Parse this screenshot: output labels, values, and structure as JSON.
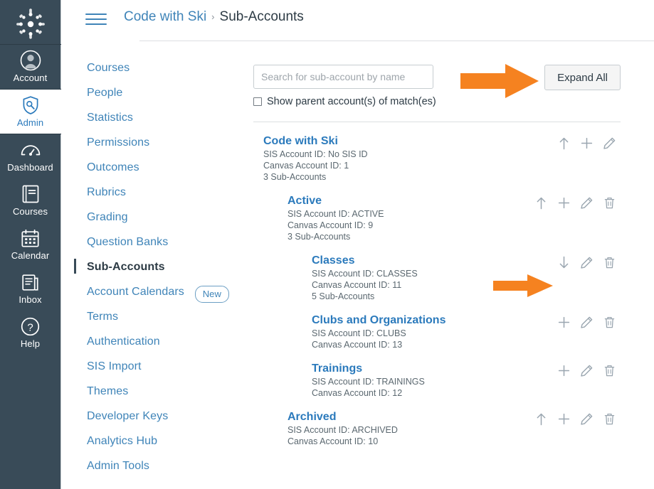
{
  "colors": {
    "global_nav_bg": "#394B58",
    "link_blue": "#3f84b8",
    "heading_blue": "#2B7ABC",
    "text_dark": "#2D3B45",
    "annotation_orange": "#F58220",
    "icon_gray": "#9aa6b0",
    "border": "#c7cdd1"
  },
  "global_nav": {
    "logo_name": "canvas-logo",
    "items": [
      {
        "label": "Account",
        "icon": "user-avatar-icon",
        "active": false
      },
      {
        "label": "Admin",
        "icon": "shield-wrench-icon",
        "active": true
      },
      {
        "label": "Dashboard",
        "icon": "dashboard-gauge-icon",
        "active": false
      },
      {
        "label": "Courses",
        "icon": "book-icon",
        "active": false
      },
      {
        "label": "Calendar",
        "icon": "calendar-icon",
        "active": false
      },
      {
        "label": "Inbox",
        "icon": "inbox-tray-icon",
        "active": false
      },
      {
        "label": "Help",
        "icon": "question-circle-icon",
        "active": false
      }
    ]
  },
  "header": {
    "menu_icon": "hamburger-menu-icon",
    "breadcrumb": {
      "root": "Code with Ski",
      "separator": "›",
      "current": "Sub-Accounts"
    }
  },
  "account_nav": {
    "items": [
      {
        "label": "Courses",
        "active": false
      },
      {
        "label": "People",
        "active": false
      },
      {
        "label": "Statistics",
        "active": false
      },
      {
        "label": "Permissions",
        "active": false
      },
      {
        "label": "Outcomes",
        "active": false
      },
      {
        "label": "Rubrics",
        "active": false
      },
      {
        "label": "Grading",
        "active": false
      },
      {
        "label": "Question Banks",
        "active": false
      },
      {
        "label": "Sub-Accounts",
        "active": true
      },
      {
        "label": "Account Calendars",
        "active": false,
        "badge": "New"
      },
      {
        "label": "Terms",
        "active": false
      },
      {
        "label": "Authentication",
        "active": false
      },
      {
        "label": "SIS Import",
        "active": false
      },
      {
        "label": "Themes",
        "active": false
      },
      {
        "label": "Developer Keys",
        "active": false
      },
      {
        "label": "Analytics Hub",
        "active": false
      },
      {
        "label": "Admin Tools",
        "active": false
      }
    ]
  },
  "toolbar": {
    "search_value": "",
    "search_placeholder": "Search for sub-account by name",
    "expand_all_label": "Expand All",
    "show_parents_label": "Show parent account(s) of match(es)",
    "show_parents_checked": false
  },
  "accounts": [
    {
      "name": "Code with Ski",
      "depth": 0,
      "sis_id_line": "SIS Account ID: No SIS ID",
      "canvas_id_line": "Canvas Account ID: 1",
      "sub_count_line": "3 Sub-Accounts",
      "actions": [
        "collapse-arrow-up-icon",
        "add-subaccount-plus-icon",
        "edit-pencil-icon"
      ]
    },
    {
      "name": "Active",
      "depth": 1,
      "sis_id_line": "SIS Account ID: ACTIVE",
      "canvas_id_line": "Canvas Account ID: 9",
      "sub_count_line": "3 Sub-Accounts",
      "actions": [
        "collapse-arrow-up-icon",
        "add-subaccount-plus-icon",
        "edit-pencil-icon",
        "delete-trash-icon"
      ]
    },
    {
      "name": "Classes",
      "depth": 2,
      "sis_id_line": "SIS Account ID: CLASSES",
      "canvas_id_line": "Canvas Account ID: 11",
      "sub_count_line": "5 Sub-Accounts",
      "actions": [
        "expand-arrow-down-icon",
        "edit-pencil-icon",
        "delete-trash-icon"
      ]
    },
    {
      "name": "Clubs and Organizations",
      "depth": 2,
      "sis_id_line": "SIS Account ID: CLUBS",
      "canvas_id_line": "Canvas Account ID: 13",
      "sub_count_line": "",
      "actions": [
        "add-subaccount-plus-icon",
        "edit-pencil-icon",
        "delete-trash-icon"
      ]
    },
    {
      "name": "Trainings",
      "depth": 2,
      "sis_id_line": "SIS Account ID: TRAININGS",
      "canvas_id_line": "Canvas Account ID: 12",
      "sub_count_line": "",
      "actions": [
        "add-subaccount-plus-icon",
        "edit-pencil-icon",
        "delete-trash-icon"
      ]
    },
    {
      "name": "Archived",
      "depth": 1,
      "sis_id_line": "SIS Account ID: ARCHIVED",
      "canvas_id_line": "Canvas Account ID: 10",
      "sub_count_line": "",
      "actions": [
        "collapse-arrow-up-icon",
        "add-subaccount-plus-icon",
        "edit-pencil-icon",
        "delete-trash-icon"
      ]
    }
  ],
  "annotations": [
    {
      "name": "arrow-pointing-to-expand-all",
      "icon": "right-arrow-annotation"
    },
    {
      "name": "arrow-pointing-to-classes-expand",
      "icon": "right-arrow-annotation"
    }
  ]
}
